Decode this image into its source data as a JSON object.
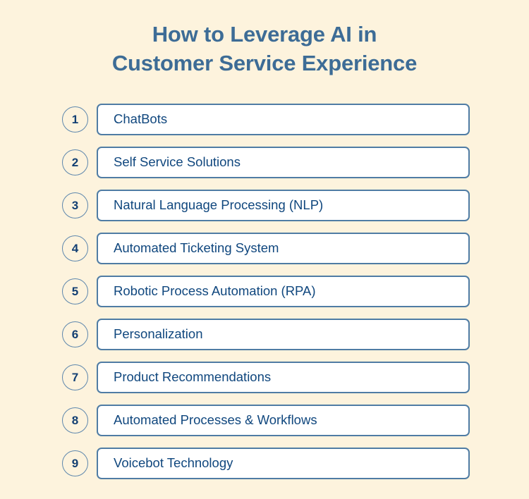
{
  "page": {
    "background_color": "#fdf3dd"
  },
  "title": {
    "line1": "How to Leverage AI in",
    "line2": "Customer Service Experience",
    "color": "#3d6c96"
  },
  "list": {
    "accent_color": "#4f7ca4",
    "text_color": "#10477e",
    "items": [
      {
        "number": "1",
        "label": "ChatBots"
      },
      {
        "number": "2",
        "label": "Self Service Solutions"
      },
      {
        "number": "3",
        "label": "Natural Language Processing (NLP)"
      },
      {
        "number": "4",
        "label": "Automated Ticketing System"
      },
      {
        "number": "5",
        "label": "Robotic Process Automation (RPA)"
      },
      {
        "number": "6",
        "label": "Personalization"
      },
      {
        "number": "7",
        "label": "Product Recommendations"
      },
      {
        "number": "8",
        "label": "Automated Processes & Workflows"
      },
      {
        "number": "9",
        "label": "Voicebot Technology"
      }
    ]
  }
}
